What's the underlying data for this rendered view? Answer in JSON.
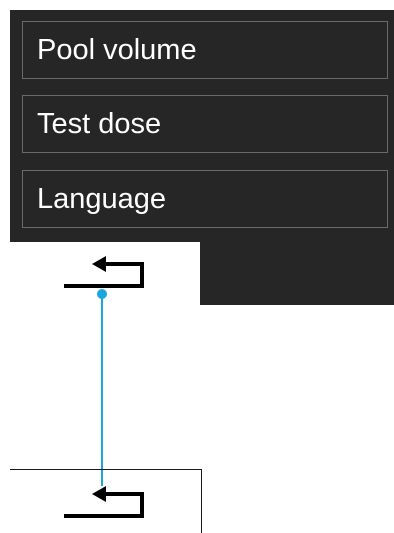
{
  "menu": {
    "items": [
      {
        "label": "Pool volume"
      },
      {
        "label": "Test dose"
      },
      {
        "label": "Language"
      }
    ]
  },
  "back_button": {
    "icon": "return-arrow-icon"
  },
  "connector": {
    "color": "#1aa7dd"
  },
  "colors": {
    "panel_background": "#262626",
    "item_border": "#6a6a6a",
    "item_text": "#ffffff"
  }
}
